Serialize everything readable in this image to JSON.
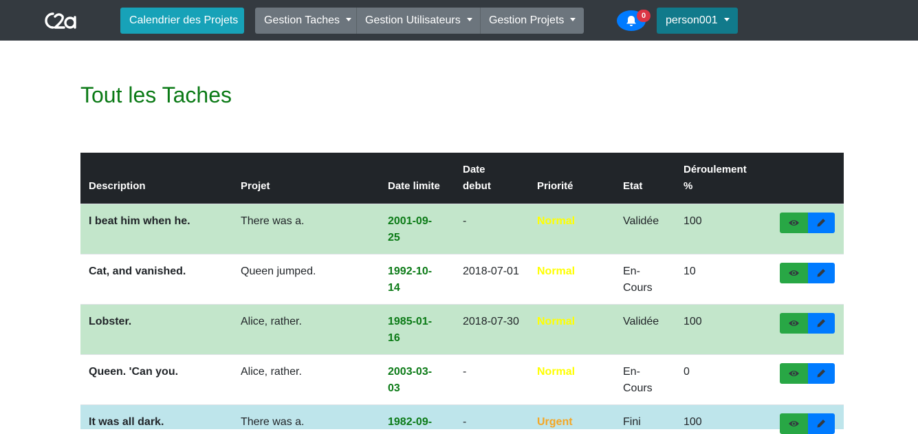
{
  "navbar": {
    "logo_text": "C2a",
    "calendar_label": "Calendrier des Projets",
    "menus": [
      "Gestion Taches",
      "Gestion Utilisateurs",
      "Gestion Projets"
    ],
    "notification_count": "0",
    "user_label": "person001",
    "icons": {
      "bell": "bell-icon",
      "caret": "caret-down-icon"
    },
    "colors": {
      "background": "#343a40",
      "calendar": "#17a2b8",
      "menus": "#6c757d",
      "bell": "#007bff",
      "badge": "#dc3545",
      "user": "#117a8b"
    }
  },
  "page": {
    "title": "Tout les Taches",
    "title_color": "#0b7a16"
  },
  "table": {
    "headers": {
      "description": "Description",
      "projet": "Projet",
      "date_limite": "Date limite",
      "date_debut_1": "Date",
      "date_debut_2": "debut",
      "priorite": "Priorité",
      "etat": "Etat",
      "deroulement_1": "Déroulement",
      "deroulement_2": "%"
    },
    "rows": [
      {
        "description": "I beat him when he.",
        "projet": "There was a.",
        "date_1": "2001-09-",
        "date_2": "25",
        "debut": "-",
        "priorite": "Normal",
        "etat_1": "Validée",
        "etat_2": "",
        "deroulement": "100",
        "status": "green"
      },
      {
        "description": "Cat, and vanished.",
        "projet": "Queen jumped.",
        "date_1": "1992-10-",
        "date_2": "14",
        "debut": "2018-07-01",
        "priorite": "Normal",
        "etat_1": "En-",
        "etat_2": "Cours",
        "deroulement": "10",
        "status": "white"
      },
      {
        "description": "Lobster.",
        "projet": "Alice, rather.",
        "date_1": "1985-01-",
        "date_2": "16",
        "debut": "2018-07-30",
        "priorite": "Normal",
        "etat_1": "Validée",
        "etat_2": "",
        "deroulement": "100",
        "status": "green"
      },
      {
        "description": "Queen. 'Can you.",
        "projet": "Alice, rather.",
        "date_1": "2003-03-",
        "date_2": "03",
        "debut": "-",
        "priorite": "Normal",
        "etat_1": "En-",
        "etat_2": "Cours",
        "deroulement": "0",
        "status": "white"
      },
      {
        "description": "It was all dark.",
        "projet": "There was a.",
        "date_1": "1982-09-",
        "date_2": "",
        "debut": "-",
        "priorite": "Urgent",
        "etat_1": "Fini",
        "etat_2": "",
        "deroulement": "100",
        "status": "blue"
      }
    ],
    "priority_colors": {
      "Normal": "#ffff00",
      "Urgent": "#f5a623"
    },
    "row_colors": {
      "green": "#c3e6cb",
      "white": "#ffffff",
      "blue": "#bee5eb"
    },
    "action_icons": {
      "view": "eye-icon",
      "edit": "pencil-icon"
    }
  }
}
